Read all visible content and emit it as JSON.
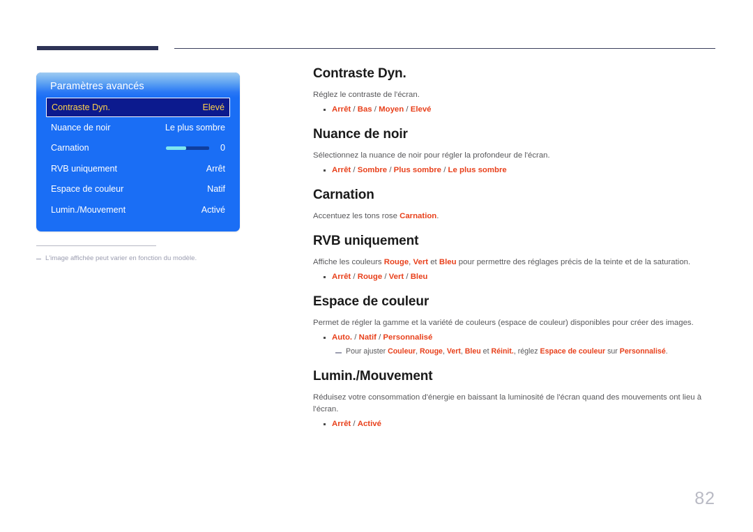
{
  "page": {
    "number": "82"
  },
  "osd": {
    "title": "Paramètres avancés",
    "rows": [
      {
        "label": "Contraste Dyn.",
        "value": "Elevé",
        "selected": true,
        "type": "value"
      },
      {
        "label": "Nuance de noir",
        "value": "Le plus sombre",
        "selected": false,
        "type": "value"
      },
      {
        "label": "Carnation",
        "value": "0",
        "selected": false,
        "type": "slider",
        "slider_percent": 46
      },
      {
        "label": "RVB uniquement",
        "value": "Arrêt",
        "selected": false,
        "type": "value"
      },
      {
        "label": "Espace de couleur",
        "value": "Natif",
        "selected": false,
        "type": "value"
      },
      {
        "label": "Lumin./Mouvement",
        "value": "Activé",
        "selected": false,
        "type": "value"
      }
    ]
  },
  "figure_note": {
    "text": "L'image affichée peut varier en fonction du modèle."
  },
  "sections": [
    {
      "title": "Contraste Dyn.",
      "desc": "Réglez le contraste de l'écran.",
      "options": [
        "Arrêt",
        "Bas",
        "Moyen",
        "Elevé"
      ]
    },
    {
      "title": "Nuance de noir",
      "desc": "Sélectionnez la nuance de noir pour régler la profondeur de l'écran.",
      "options": [
        "Arrêt",
        "Sombre",
        "Plus sombre",
        "Le plus sombre"
      ]
    },
    {
      "title": "Carnation",
      "desc_parts": [
        {
          "t": "Accentuez les tons rose ",
          "hl": false
        },
        {
          "t": "Carnation",
          "hl": true
        },
        {
          "t": ".",
          "hl": false
        }
      ],
      "options": []
    },
    {
      "title": "RVB uniquement",
      "desc_parts": [
        {
          "t": "Affiche les couleurs ",
          "hl": false
        },
        {
          "t": "Rouge",
          "hl": true
        },
        {
          "t": ", ",
          "hl": false
        },
        {
          "t": "Vert",
          "hl": true
        },
        {
          "t": " et ",
          "hl": false
        },
        {
          "t": "Bleu",
          "hl": true
        },
        {
          "t": " pour permettre des réglages précis de la teinte et de la saturation.",
          "hl": false
        }
      ],
      "options": [
        "Arrêt",
        "Rouge",
        "Vert",
        "Bleu"
      ]
    },
    {
      "title": "Espace de couleur",
      "desc": "Permet de régler la gamme et la variété de couleurs (espace de couleur) disponibles pour créer des images.",
      "options": [
        "Auto.",
        "Natif",
        "Personnalisé"
      ],
      "subnote_parts": [
        {
          "t": "Pour ajuster ",
          "hl": false
        },
        {
          "t": "Couleur",
          "hl": true
        },
        {
          "t": ", ",
          "hl": false
        },
        {
          "t": "Rouge",
          "hl": true
        },
        {
          "t": ", ",
          "hl": false
        },
        {
          "t": "Vert",
          "hl": true
        },
        {
          "t": ", ",
          "hl": false
        },
        {
          "t": "Bleu",
          "hl": true
        },
        {
          "t": " et ",
          "hl": false
        },
        {
          "t": "Réinit.",
          "hl": true
        },
        {
          "t": ", réglez ",
          "hl": false
        },
        {
          "t": "Espace de couleur",
          "hl": true
        },
        {
          "t": " sur ",
          "hl": false
        },
        {
          "t": "Personnalisé",
          "hl": true
        },
        {
          "t": ".",
          "hl": false
        }
      ]
    },
    {
      "title": "Lumin./Mouvement",
      "desc": "Réduisez votre consommation d'énergie en baissant la luminosité de l'écran quand des mouvements ont lieu à l'écran.",
      "options": [
        "Arrêt",
        "Activé"
      ]
    }
  ],
  "colors": {
    "accent": "#e8411c",
    "osd_blue": "#1a6ef5",
    "osd_selected": "#0c1a8e",
    "osd_selected_text": "#ffd24a",
    "rule_navy": "#2e3356",
    "body_text": "#58585b"
  }
}
